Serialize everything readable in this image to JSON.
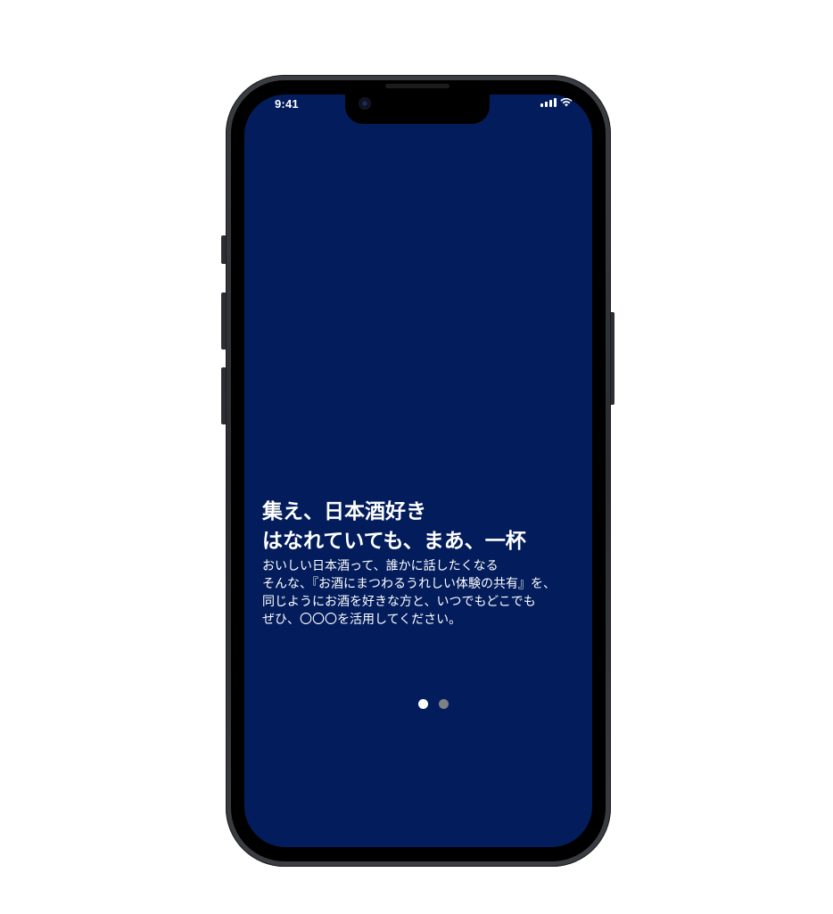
{
  "status_bar": {
    "time": "9:41",
    "signal_icon": "cellular-signal-icon",
    "wifi_icon": "wifi-icon"
  },
  "onboarding": {
    "headline": [
      "集え、日本酒好き",
      "はなれていても、まあ、一杯"
    ],
    "body": [
      "おいしい日本酒って、誰かに話したくなる",
      "そんな、『お酒にまつわるうれしい体験の共有』を、",
      "同じようにお酒を好きな方と、いつでもどこでも",
      "ぜひ、〇〇〇を活用してください。"
    ],
    "pager": {
      "current_page": 1,
      "total_pages": 2
    }
  },
  "colors": {
    "screen_background": "#031d5c",
    "text": "#ffffff",
    "dot_active": "#ffffff",
    "dot_inactive": "#7f7f88"
  }
}
